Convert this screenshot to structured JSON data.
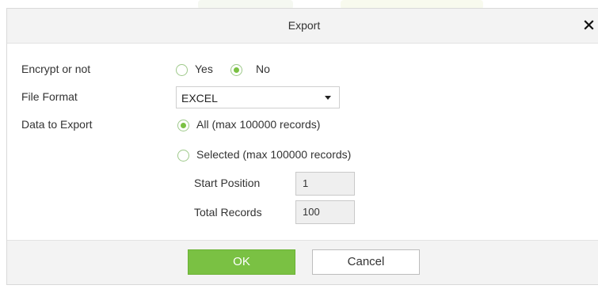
{
  "dialog": {
    "title": "Export",
    "close_icon": "close-icon"
  },
  "form": {
    "encrypt_label": "Encrypt or not",
    "encrypt_options": [
      "Yes",
      "No"
    ],
    "encrypt_selected": "No",
    "file_format_label": "File Format",
    "file_format_value": "EXCEL",
    "data_label": "Data to Export",
    "data_all_label": "All (max 100000 records)",
    "data_selected_label": "Selected (max 100000 records)",
    "data_selected_option": "All",
    "start_position_label": "Start Position",
    "start_position_value": "1",
    "total_records_label": "Total Records",
    "total_records_value": "100"
  },
  "footer": {
    "ok_label": "OK",
    "cancel_label": "Cancel"
  },
  "colors": {
    "accent": "#7ac143",
    "header_bg": "#f3f3f3"
  }
}
